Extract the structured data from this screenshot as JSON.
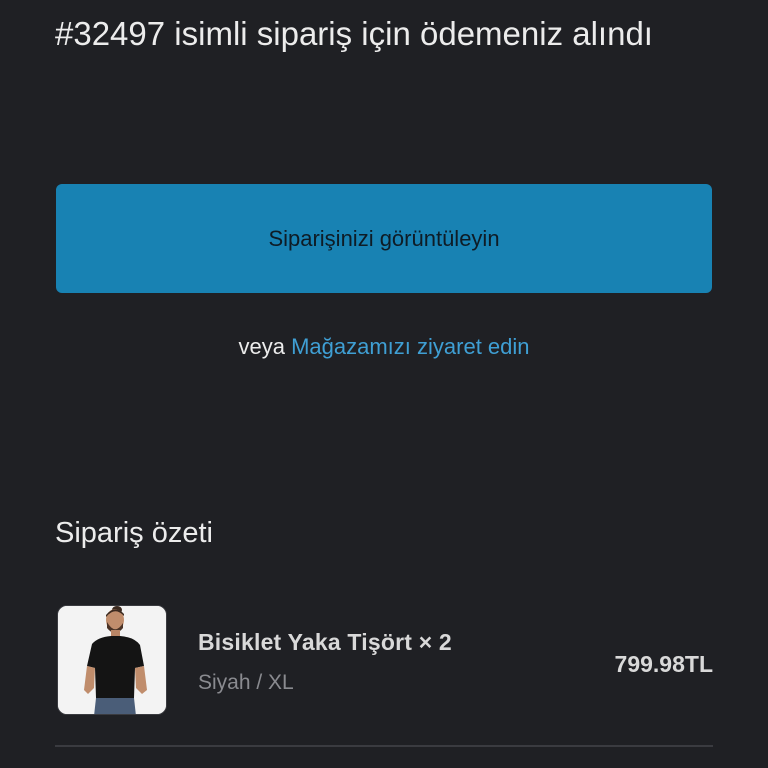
{
  "confirmation": {
    "headline": "#32497 isimli sipariş için ödemeniz alındı",
    "view_order_label": "Siparişinizi görüntüleyin",
    "or_text": "veya",
    "store_link_label": "Mağazamızı ziyaret edin"
  },
  "summary": {
    "title": "Sipariş özeti",
    "items": [
      {
        "name": "Bisiklet Yaka Tişört × 2",
        "variant": "Siyah / XL",
        "price": "799.98TL",
        "image_icon": "product-photo-black-tshirt"
      }
    ]
  },
  "colors": {
    "background": "#1f2024",
    "accent_button": "#1882b3",
    "link": "#3f9fd4",
    "muted_text": "#8a8b90"
  }
}
